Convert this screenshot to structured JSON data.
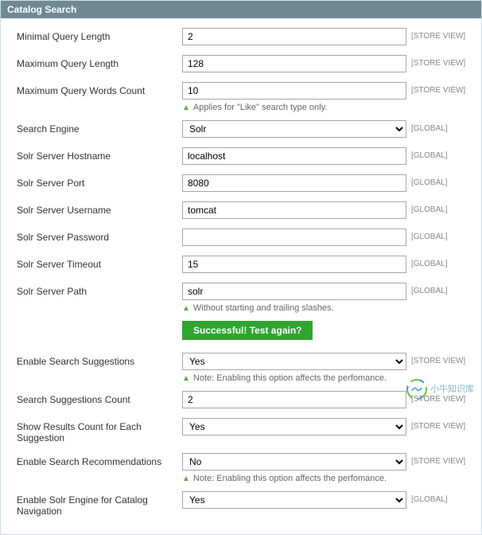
{
  "header": {
    "title": "Catalog Search"
  },
  "scopes": {
    "store": "[STORE VIEW]",
    "global": "[GLOBAL]"
  },
  "notes": {
    "like_only": "Applies for \"Like\" search type only.",
    "no_slashes": "Without starting and trailing slashes.",
    "perf": "Note: Enabling this option affects the perfomance."
  },
  "button": {
    "test": "Successful! Test again?"
  },
  "fields": {
    "min_query_len": {
      "label": "Minimal Query Length",
      "value": "2"
    },
    "max_query_len": {
      "label": "Maximum Query Length",
      "value": "128"
    },
    "max_query_words": {
      "label": "Maximum Query Words Count",
      "value": "10"
    },
    "search_engine": {
      "label": "Search Engine",
      "value": "Solr"
    },
    "solr_host": {
      "label": "Solr Server Hostname",
      "value": "localhost"
    },
    "solr_port": {
      "label": "Solr Server Port",
      "value": "8080"
    },
    "solr_user": {
      "label": "Solr Server Username",
      "value": "tomcat"
    },
    "solr_pass": {
      "label": "Solr Server Password",
      "value": ""
    },
    "solr_timeout": {
      "label": "Solr Server Timeout",
      "value": "15"
    },
    "solr_path": {
      "label": "Solr Server Path",
      "value": "solr"
    },
    "suggest_enable": {
      "label": "Enable Search Suggestions",
      "value": "Yes"
    },
    "suggest_count": {
      "label": "Search Suggestions Count",
      "value": "2"
    },
    "suggest_show_count": {
      "label": "Show Results Count for Each Suggestion",
      "value": "Yes"
    },
    "recommend_enable": {
      "label": "Enable Search Recommendations",
      "value": "No"
    },
    "solr_nav": {
      "label": "Enable Solr Engine for Catalog Navigation",
      "value": "Yes"
    }
  },
  "watermark": "小牛知识库"
}
